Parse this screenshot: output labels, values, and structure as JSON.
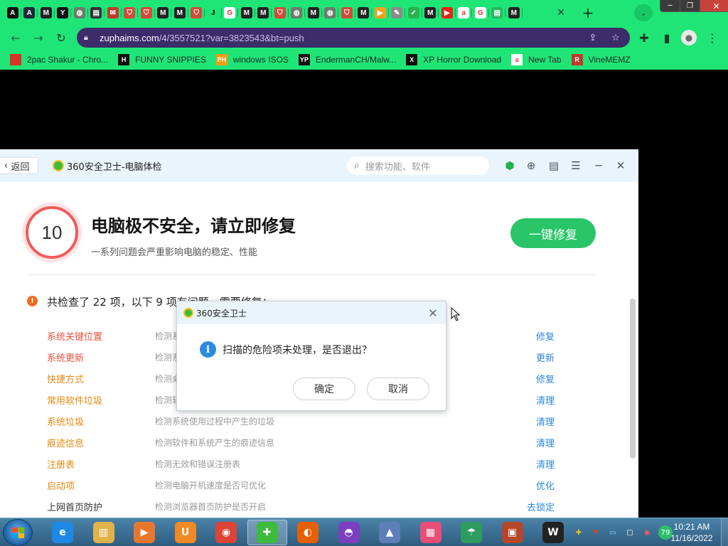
{
  "browser": {
    "tabs": [
      {
        "icon": "A",
        "color": "#111111"
      },
      {
        "icon": "A",
        "color": "#1b2b3a"
      },
      {
        "icon": "M",
        "color": "#222222"
      },
      {
        "icon": "Y",
        "color": "#111111"
      },
      {
        "icon": "globe",
        "color": "#6b7c6b"
      },
      {
        "icon": "doc",
        "color": "#333333"
      },
      {
        "icon": "mail",
        "color": "#c0392b"
      },
      {
        "icon": "shield",
        "color": "#d14a3a"
      },
      {
        "icon": "shield",
        "color": "#d14a3a"
      },
      {
        "icon": "M",
        "color": "#222222"
      },
      {
        "icon": "M",
        "color": "#222222"
      },
      {
        "icon": "shield",
        "color": "#d14a3a"
      },
      {
        "icon": "J",
        "color": "#1fe577"
      },
      {
        "icon": "G",
        "color": "#ffffff"
      },
      {
        "icon": "M",
        "color": "#222222"
      },
      {
        "icon": "M",
        "color": "#222222"
      },
      {
        "icon": "shield",
        "color": "#d14a3a"
      },
      {
        "icon": "globe",
        "color": "#6b7c6b"
      },
      {
        "icon": "M",
        "color": "#222222"
      },
      {
        "icon": "globe",
        "color": "#6b7c6b"
      },
      {
        "icon": "shield",
        "color": "#d14a3a"
      },
      {
        "icon": "M",
        "color": "#222222"
      },
      {
        "icon": "play",
        "color": "#f0a21e"
      },
      {
        "icon": "puzzle",
        "color": "#8a8a8a"
      },
      {
        "icon": "check",
        "color": "#2ab24e"
      },
      {
        "icon": "M",
        "color": "#222222"
      },
      {
        "icon": "yt",
        "color": "#e62117"
      },
      {
        "icon": "a",
        "color": "#ffffff"
      },
      {
        "icon": "G",
        "color": "#ffffff"
      },
      {
        "icon": "doc",
        "color": "#28b85e"
      },
      {
        "icon": "M",
        "color": "#222222"
      }
    ],
    "url_host": "zuphaims.com",
    "url_path": "/4/3557521?var=3823543&bt=push",
    "bookmarks": [
      {
        "label": "2pac Shakur - Chro...",
        "icon_color": "#d8322a"
      },
      {
        "label": "FUNNY SNIPPIES",
        "icon_color": "#111111",
        "icon_text": "H"
      },
      {
        "label": "windows ISOS",
        "icon_color": "#f39c12",
        "icon_text": "PH"
      },
      {
        "label": "EndermanCH/Malw...",
        "icon_color": "#111111",
        "icon_text": "YP"
      },
      {
        "label": "XP Horror Download",
        "icon_color": "#111111",
        "icon_text": "X"
      },
      {
        "label": "New Tab",
        "icon_color": "#ffffff",
        "icon_text": "a"
      },
      {
        "label": "VineMEMZ",
        "icon_color": "#c0392b",
        "icon_text": "R"
      }
    ]
  },
  "app": {
    "back_label": "返回",
    "title": "360安全卫士-电脑体检",
    "search_placeholder": "搜索功能、软件",
    "score": "10",
    "status_title": "电脑极不安全，请立即修复",
    "status_sub": "一系列问题会严重影响电脑的稳定、性能",
    "fix_all_label": "一键修复",
    "summary": "共检查了 22 项，以下 9 项有问题，需要修复：",
    "issues": [
      {
        "name": "系统关键位置",
        "desc": "检测系统关键位置是否被篡改",
        "action": "修复",
        "level": "danger"
      },
      {
        "name": "系统更新",
        "desc": "检测系统是否有可用更新",
        "action": "更新",
        "level": "danger"
      },
      {
        "name": "快捷方式",
        "desc": "检测桌面快捷方式是否被篡改",
        "action": "修复",
        "level": "warn"
      },
      {
        "name": "常用软件垃圾",
        "desc": "检测软件使用过程中产生的垃圾",
        "action": "清理",
        "level": "warn"
      },
      {
        "name": "系统垃圾",
        "desc": "检测系统使用过程中产生的垃圾",
        "action": "清理",
        "level": "warn"
      },
      {
        "name": "痕迹信息",
        "desc": "检测软件和系统产生的痕迹信息",
        "action": "清理",
        "level": "warn"
      },
      {
        "name": "注册表",
        "desc": "检测无效和错误注册表",
        "action": "清理",
        "level": "warn"
      },
      {
        "name": "启动项",
        "desc": "检测电脑开机速度是否可优化",
        "action": "优化",
        "level": "warn"
      },
      {
        "name": "上网首页防护",
        "desc": "检测浏览器首页防护是否开启",
        "action": "去锁定",
        "level": "plain"
      }
    ]
  },
  "dialog": {
    "title": "360安全卫士",
    "message": "扫描的危险项未处理，是否退出？",
    "ok_label": "确定",
    "cancel_label": "取消"
  },
  "taskbar": {
    "apps": [
      {
        "name": "ie",
        "color": "#1e88e5"
      },
      {
        "name": "explorer",
        "color": "#e0b34a"
      },
      {
        "name": "media",
        "color": "#e8772e"
      },
      {
        "name": "uc",
        "color": "#f08a24"
      },
      {
        "name": "chrome",
        "color": "#db4437"
      },
      {
        "name": "360",
        "color": "#3dbb3d"
      },
      {
        "name": "firefox",
        "color": "#e66000"
      },
      {
        "name": "mask",
        "color": "#7b3fbf"
      },
      {
        "name": "rocket",
        "color": "#5d7fb8"
      },
      {
        "name": "tiles",
        "color": "#e94e77"
      },
      {
        "name": "umbrella",
        "color": "#2e9b5f"
      },
      {
        "name": "box",
        "color": "#b5462a"
      },
      {
        "name": "winrar",
        "color": "#222222"
      }
    ],
    "tray_badge": "79",
    "time": "10:21 AM",
    "date": "11/16/2022"
  }
}
